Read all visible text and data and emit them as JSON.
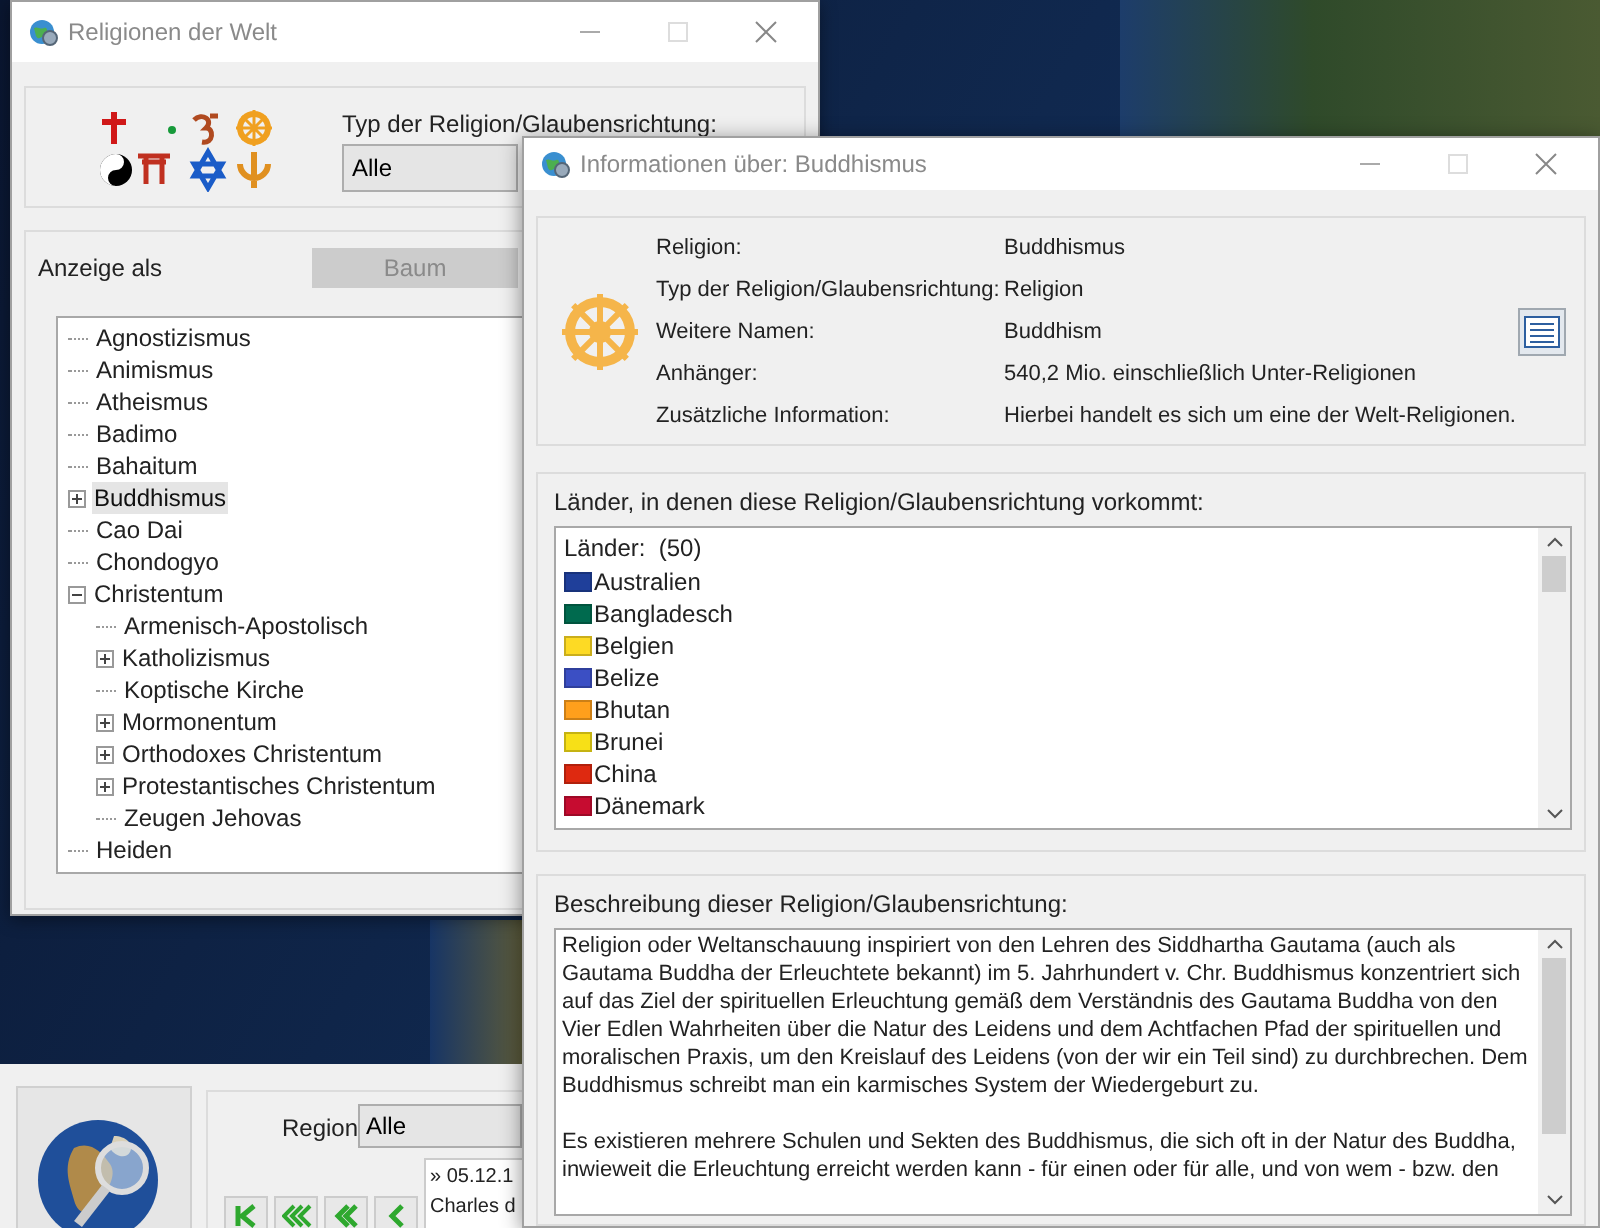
{
  "background_app": {
    "region_label": "Region",
    "region_value": "Alle",
    "log_lines": [
      "» 05.12.1",
      "Charles d"
    ]
  },
  "main_window": {
    "title": "Religionen der Welt",
    "type_label": "Typ der Religion/Glaubensrichtung:",
    "type_value": "Alle",
    "display_label": "Anzeige als",
    "view_button": {
      "label": "Baum",
      "selected": true
    },
    "tree": [
      {
        "label": "Agnostizismus",
        "selected": false
      },
      {
        "label": "Animismus",
        "selected": false
      },
      {
        "label": "Atheismus",
        "selected": false
      },
      {
        "label": "Badimo",
        "selected": false
      },
      {
        "label": "Bahaitum",
        "selected": false
      },
      {
        "label": "Buddhismus",
        "selected": true,
        "expanded": false
      },
      {
        "label": "Cao Dai",
        "selected": false
      },
      {
        "label": "Chondogyo",
        "selected": false
      },
      {
        "label": "Christentum",
        "selected": false,
        "expanded": true,
        "children": [
          {
            "label": "Armenisch-Apostolisch",
            "selected": false
          },
          {
            "label": "Katholizismus",
            "selected": false,
            "expanded": false
          },
          {
            "label": "Koptische Kirche",
            "selected": false
          },
          {
            "label": "Mormonentum",
            "selected": false,
            "expanded": false
          },
          {
            "label": "Orthodoxes Christentum",
            "selected": false,
            "expanded": false
          },
          {
            "label": "Protestantisches Christentum",
            "selected": false,
            "expanded": false
          },
          {
            "label": "Zeugen Jehovas",
            "selected": false
          }
        ]
      },
      {
        "label": "Heiden",
        "selected": false
      }
    ]
  },
  "info_window": {
    "title": "Informationen über: Buddhismus",
    "fields": [
      {
        "label": "Religion:",
        "value": "Buddhismus"
      },
      {
        "label": "Typ der Religion/Glaubensrichtung:",
        "value": "Religion"
      },
      {
        "label": "Weitere Namen:",
        "value": "Buddhism"
      },
      {
        "label": "Anhänger:",
        "value": "540,2 Mio. einschließlich Unter-Religionen"
      },
      {
        "label": "Zusätzliche Information:",
        "value": "Hierbei handelt es sich um eine der Welt-Religionen."
      }
    ],
    "countries_label": "Länder, in denen diese Religion/Glaubensrichtung vorkommt:",
    "countries_header": "Länder:  (50)",
    "countries": [
      {
        "name": "Australien",
        "color": "#1f3f9a"
      },
      {
        "name": "Bangladesch",
        "color": "#006a4e"
      },
      {
        "name": "Belgien",
        "color": "#fdda24"
      },
      {
        "name": "Belize",
        "color": "#3b4fc4"
      },
      {
        "name": "Bhutan",
        "color": "#ff9f1c"
      },
      {
        "name": "Brunei",
        "color": "#f7e017"
      },
      {
        "name": "China",
        "color": "#de2910"
      },
      {
        "name": "Dänemark",
        "color": "#c60c30"
      }
    ],
    "description_label": "Beschreibung dieser Religion/Glaubensrichtung:",
    "description": [
      "Religion oder Weltanschauung inspiriert von den Lehren des Siddhartha Gautama (auch als Gautama Buddha der Erleuchtete bekannt) im 5. Jahrhundert v. Chr. Buddhismus konzentriert sich auf das Ziel der spirituellen Erleuchtung gemäß dem Verständnis des Gautama Buddha von den Vier Edlen Wahrheiten über die Natur des Leidens und dem Achtfachen Pfad der spirituellen und moralischen Praxis, um den Kreislauf des Leidens (von der wir ein Teil sind) zu durchbrechen. Dem Buddhismus schreibt man ein karmisches System der Wiedergeburt zu.",
      "Es existieren mehrere Schulen und Sekten des Buddhismus, die sich oft in der Natur des Buddha, inwieweit die Erleuchtung erreicht werden kann - für einen oder für alle, und von wem - bzw. den"
    ]
  }
}
